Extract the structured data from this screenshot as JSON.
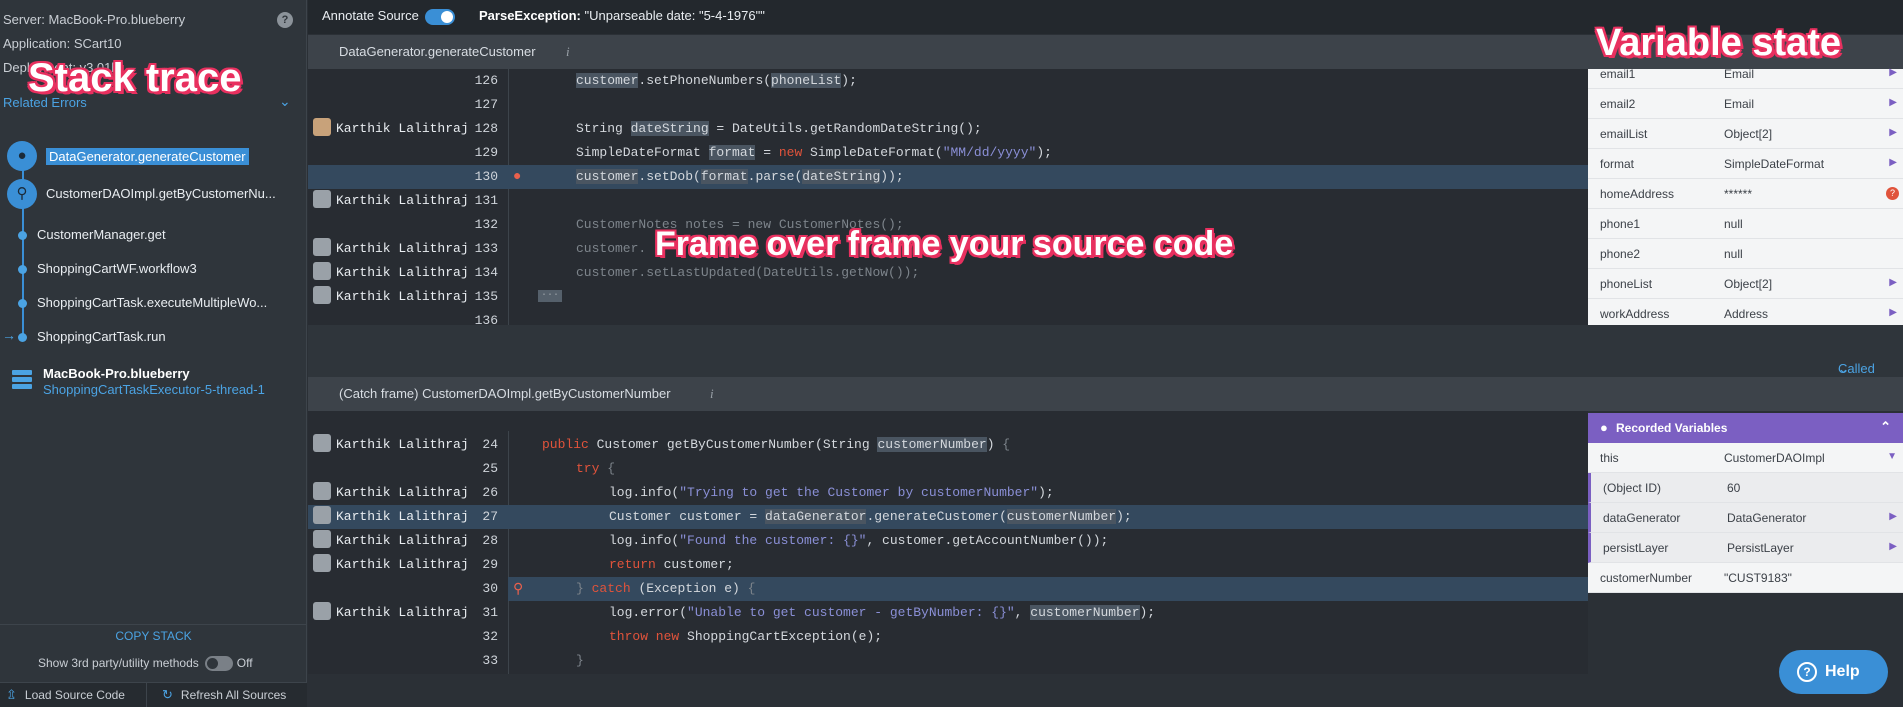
{
  "sidebar": {
    "server": "Server: MacBook-Pro.blueberry",
    "application": "Application: SCart10",
    "deployment": "Deployment: v3.01b",
    "related_errors": "Related Errors",
    "frames": [
      {
        "label": "DataGenerator.generateCustomer"
      },
      {
        "label": "CustomerDAOImpl.getByCustomerNu..."
      },
      {
        "label": "CustomerManager.get"
      },
      {
        "label": "ShoppingCartWF.workflow3"
      },
      {
        "label": "ShoppingCartTask.executeMultipleWo..."
      },
      {
        "label": "ShoppingCartTask.run"
      }
    ],
    "host": "MacBook-Pro.blueberry",
    "thread": "ShoppingCartTaskExecutor-5-thread-1",
    "copy_stack": "COPY STACK",
    "third_party": "Show 3rd party/utility methods",
    "third_party_state": "Off",
    "load_source": "Load Source Code",
    "refresh_sources": "Refresh All Sources"
  },
  "overlays": {
    "stack_trace": "Stack trace",
    "variable_state": "Variable state",
    "frame_over_frame": "Frame over frame your source code"
  },
  "topbar": {
    "annotate": "Annotate Source",
    "exception_name": "ParseException:",
    "exception_msg": "\"Unparseable date: \"5-4-1976\"\""
  },
  "frame1": {
    "title": "DataGenerator.generateCustomer",
    "authors": {
      "128": "Karthik Lalithraj",
      "131": "Karthik Lalithraj",
      "133": "Karthik Lalithraj",
      "134": "Karthik Lalithraj",
      "135": "Karthik Lalithraj"
    },
    "lines": [
      "126",
      "127",
      "128",
      "129",
      "130",
      "131",
      "132",
      "133",
      "134",
      "135",
      "136"
    ]
  },
  "called_by": "Called by",
  "frame2": {
    "title": "(Catch frame) CustomerDAOImpl.getByCustomerNumber",
    "author": "Karthik Lalithraj",
    "lines": [
      "24",
      "25",
      "26",
      "27",
      "28",
      "29",
      "30",
      "31",
      "32",
      "33"
    ]
  },
  "vars_top": [
    {
      "name": "email1",
      "value": "Email"
    },
    {
      "name": "email2",
      "value": "Email"
    },
    {
      "name": "emailList",
      "value": "Object[2]"
    },
    {
      "name": "format",
      "value": "SimpleDateFormat"
    },
    {
      "name": "homeAddress",
      "value": "******"
    },
    {
      "name": "phone1",
      "value": "null"
    },
    {
      "name": "phone2",
      "value": "null"
    },
    {
      "name": "phoneList",
      "value": "Object[2]"
    },
    {
      "name": "workAddress",
      "value": "Address"
    }
  ],
  "recorded": {
    "title": "Recorded Variables",
    "rows": [
      {
        "name": "this",
        "value": "CustomerDAOImpl"
      },
      {
        "name": "(Object ID)",
        "value": "60"
      },
      {
        "name": "dataGenerator",
        "value": "DataGenerator"
      },
      {
        "name": "persistLayer",
        "value": "PersistLayer"
      },
      {
        "name": "customerNumber",
        "value": "\"CUST9183\""
      }
    ]
  },
  "help": "Help"
}
